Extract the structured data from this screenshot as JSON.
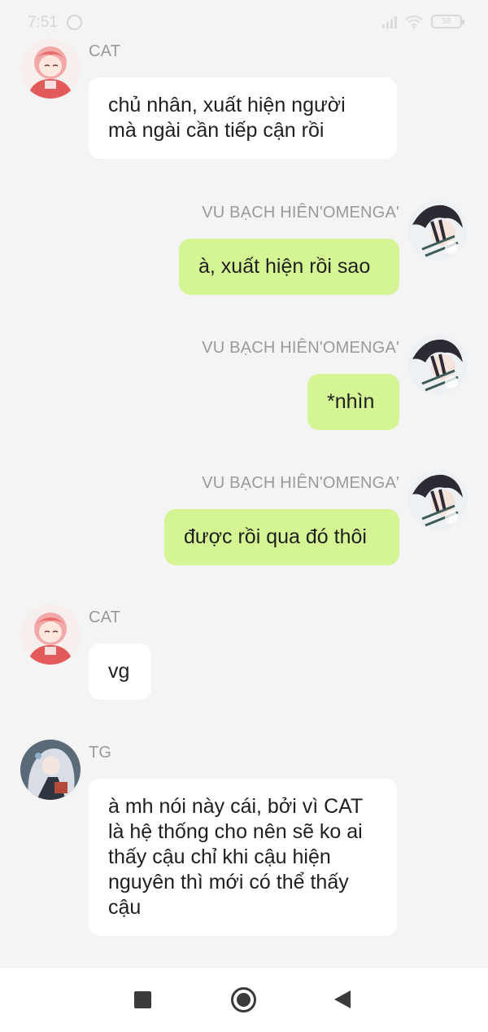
{
  "status_bar": {
    "time": "7:51",
    "battery_text": "58"
  },
  "messages": [
    {
      "sender": "CAT",
      "side": "left",
      "avatar_icon": "pink-hair-girl-avatar",
      "text": "chủ nhân, xuất hiện người mà ngài cần tiếp cận rồi"
    },
    {
      "sender": "VU BẠCH HIÊN'OMENGA'",
      "side": "right",
      "avatar_icon": "dark-hair-boy-avatar",
      "text": "à, xuất hiện rồi sao"
    },
    {
      "sender": "VU BẠCH HIÊN'OMENGA'",
      "side": "right",
      "avatar_icon": "dark-hair-boy-avatar",
      "text": "*nhìn"
    },
    {
      "sender": "VU BẠCH HIÊN'OMENGA'",
      "side": "right",
      "avatar_icon": "dark-hair-boy-avatar",
      "text": "được rồi qua đó thôi"
    },
    {
      "sender": "CAT",
      "side": "left",
      "avatar_icon": "pink-hair-girl-avatar",
      "text": "vg"
    },
    {
      "sender": "TG",
      "side": "left",
      "avatar_icon": "silver-hair-girl-avatar",
      "text": "à mh nói này cái, bởi vì CAT là hệ thống cho nên sẽ ko ai thấy cậu chỉ khi cậu hiện nguyên thì mới có thể thấy cậu"
    }
  ],
  "nav_bar": {
    "recents_icon": "square-icon",
    "home_icon": "circle-home-icon",
    "back_icon": "triangle-back-icon"
  },
  "colors": {
    "background": "#f4f4f4",
    "bubble_left": "#ffffff",
    "bubble_right": "#d5f595",
    "sender_name": "#9a9a9a"
  }
}
